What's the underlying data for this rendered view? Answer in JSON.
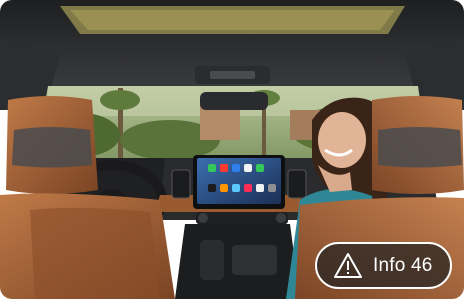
{
  "info_badge": {
    "label": "Info 46",
    "icon": "warning-triangle-icon"
  }
}
